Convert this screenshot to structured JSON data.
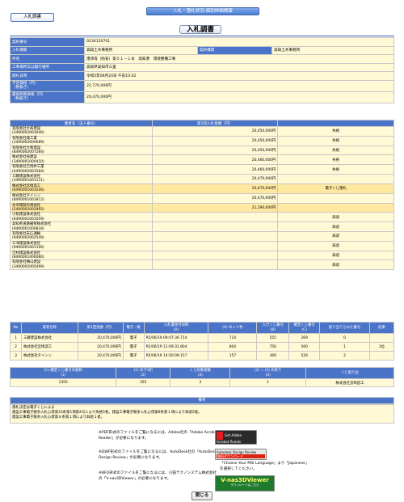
{
  "header": {
    "window_title": "入札・落札状況-個別詳細情報",
    "tab_label": "入札調書",
    "page_title": "入札調書"
  },
  "info": [
    {
      "label": "契約番号",
      "value": "0230120701"
    },
    {
      "label": "入札機関",
      "value": "高知土木事務所",
      "label2": "契約機関",
      "value2": "高知土木事務所"
    },
    {
      "label": "件名",
      "value": "港湾等（防安）第０１－１号　高知港　環境整備工事"
    },
    {
      "label": "工事場所又は履行場所",
      "value": "高知県高知市三里"
    },
    {
      "label": "開札日時",
      "value": "令和5年06月20日 午前10:02"
    },
    {
      "label": "予定価格（円）\n（税抜き）",
      "value": "22,770,000円"
    },
    {
      "label": "最低制限価格（円）\n（税抜き）",
      "value": "20,470,000円"
    }
  ],
  "bidders": {
    "headers": [
      "業者名（法人番号）",
      "第1回入札金額（円）",
      ""
    ],
    "rows": [
      {
        "name": "有限会社大寿建設",
        "corp": "(3490002003040)",
        "amount": "20,450,000円",
        "remark": "失格"
      },
      {
        "name": "有限会社城工業",
        "corp": "(1490002000089)",
        "amount": "20,450,000円",
        "remark": "失格"
      },
      {
        "name": "有限会社大和建設",
        "corp": "(8490002007284)",
        "amount": "20,450,000円",
        "remark": "失格"
      },
      {
        "name": "株式会社祐建設",
        "corp": "(3490001000410)",
        "amount": "20,460,000円",
        "remark": "失格"
      },
      {
        "name": "有限会社吉岡井工業",
        "corp": "(4490002003584)",
        "amount": "20,460,000円",
        "remark": "失格"
      },
      {
        "name": "三藤建設株式会社",
        "corp": "(3490001001111)",
        "amount": "20,470,000円",
        "remark": ""
      },
      {
        "name": "株式会社宮崎造工",
        "corp": "(6490001003206)",
        "amount": "20,470,000円",
        "remark": "電子くじ落札",
        "highlight": true
      },
      {
        "name": "株式会社タイシン",
        "corp": "(8490001003912)",
        "amount": "20,470,000円",
        "remark": ""
      },
      {
        "name": "太幸開発有限会社",
        "corp": "(2490002002992)",
        "amount": "21,290,000円",
        "remark": "",
        "highlight": true
      },
      {
        "name": "小松建設株式会社",
        "corp": "(6490001001059)",
        "amount": "",
        "remark": "辞退"
      },
      {
        "name": "高知県道路補修株式会社",
        "corp": "(9490001000818)",
        "amount": "",
        "remark": "辞退"
      },
      {
        "name": "有限会社末広運輸",
        "corp": "(9490002002549)",
        "amount": "",
        "remark": "辞退"
      },
      {
        "name": "三洋建設株式会社",
        "corp": "(9490001001106)",
        "amount": "",
        "remark": "辞退"
      },
      {
        "name": "吉村建設株式会社",
        "corp": "(8490001006080)",
        "amount": "",
        "remark": "辞退"
      },
      {
        "name": "有限会社横山建設",
        "corp": "(3490002005499)",
        "amount": "",
        "remark": "辞退"
      }
    ]
  },
  "lots": {
    "headers": [
      "No",
      "業者名称",
      "第1回金額（円）",
      "電子／紙",
      "入札書受付日時\n(A)",
      "(A) のミリ秒",
      "入力くじ番号\n(B)",
      "確定くじ番号\n(C)",
      "割り当てられた番号",
      "結果"
    ],
    "rows": [
      [
        "1",
        "三藤建設株式会社",
        "20,470,000円",
        "電子",
        "R5/06/19 09:07:36.714",
        "714",
        "555",
        "269",
        "0",
        ""
      ],
      [
        "2",
        "株式会社宮崎造工",
        "20,470,000円",
        "電子",
        "R5/06/19 11:09:31.804",
        "804",
        "756",
        "560",
        "1",
        "1位"
      ],
      [
        "3",
        "株式会社タイシン",
        "20,470,000円",
        "電子",
        "R5/06/19 14:50:09.157",
        "157",
        "369",
        "526",
        "2",
        ""
      ]
    ]
  },
  "kuji": {
    "headers": [
      "(C) 確定くじ番号の総和\n(1)",
      "(1) の下3桁\n(2)",
      "くじ対象者数\n(3)",
      "(2) ÷ (3) の余り\n(4)",
      "くじ割り位"
    ],
    "row": [
      "1355",
      "355",
      "3",
      "1",
      "株式会社宮崎造工"
    ]
  },
  "remarks": {
    "header": "備考",
    "lines": [
      "落札決定は電子くじによる",
      "建設工事電子競争入札心得第10条第1項第4号により失格5者。建設工事電子競争入札心得第8条第１項により辞退5者。",
      "建設工事電子競争入札心得第８条第１項により辞退１者。"
    ]
  },
  "notes": {
    "pdf": "※PDF形式のファイルをご覧になるには、Adobe社の「Adobe Acrobat Reader」が必要になります。",
    "dwf": "※DWF形式のファイルをご覧になるには、AutoDesk社の「AutoDesk Design Review」が必要になります。",
    "dwf_lang": "「Choose Your MSI Language」より「Japanese」を選択してください。",
    "bfo": "※BFO形式のファイルをご覧になるには、川田テクノシステム株式会社の「V-nas3DViewer」が必要になります。",
    "adobe_badge": "Get Adobe\nAcrobat Reader",
    "autodesk_badge": "Autodesk Design Review",
    "autodesk_sub": "無料ダウンロード",
    "vnas_badge": "V-nas3DViewer",
    "vnas_sub": "ダウンロードはこちら"
  },
  "footer": {
    "close_label": "閉じる"
  }
}
